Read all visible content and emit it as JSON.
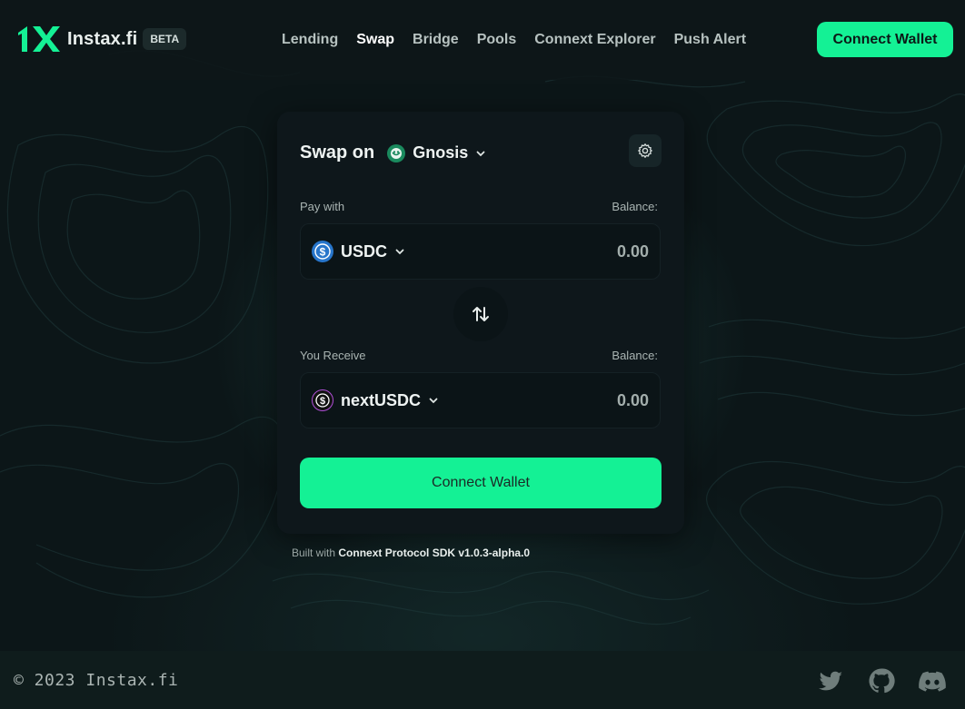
{
  "header": {
    "brand": "Instax.fi",
    "badge": "BETA",
    "nav": [
      "Lending",
      "Swap",
      "Bridge",
      "Pools",
      "Connext Explorer",
      "Push Alert"
    ],
    "active_nav": "Swap",
    "connect_label": "Connect Wallet"
  },
  "swap_card": {
    "title": "Swap on",
    "chain": "Gnosis",
    "pay": {
      "label": "Pay with",
      "balance_label": "Balance:",
      "token": "USDC",
      "amount": "0.00"
    },
    "receive": {
      "label": "You Receive",
      "balance_label": "Balance:",
      "token": "nextUSDC",
      "amount": "0.00"
    },
    "cta_label": "Connect Wallet"
  },
  "built_with": {
    "prefix": "Built with",
    "sdk": "Connext Protocol SDK v1.0.3-alpha.0"
  },
  "footer": {
    "copyright": "© 2023 Instax.fi",
    "social_icons": [
      "twitter-icon",
      "github-icon",
      "discord-icon"
    ]
  },
  "colors": {
    "accent": "#14f195",
    "background": "#0c1618",
    "card": "#0e171b",
    "usdc_blue": "#2775ca"
  }
}
